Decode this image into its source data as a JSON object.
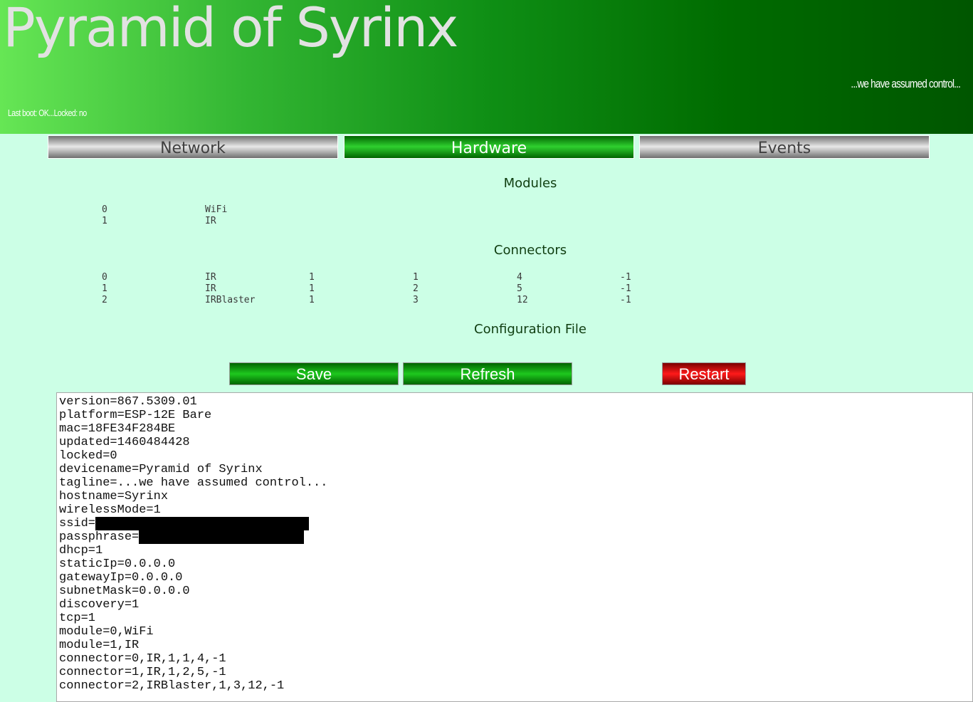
{
  "header": {
    "title": "Pyramid of Syrinx",
    "tagline": "...we have assumed control...",
    "boot_status": "Last boot: OK...Locked: no"
  },
  "tabs": [
    {
      "label": "Network",
      "active": false
    },
    {
      "label": "Hardware",
      "active": true
    },
    {
      "label": "Events",
      "active": false
    }
  ],
  "modules": {
    "heading": "Modules",
    "rows": [
      {
        "id": "0",
        "name": "WiFi"
      },
      {
        "id": "1",
        "name": "IR"
      }
    ]
  },
  "connectors": {
    "heading": "Connectors",
    "rows": [
      {
        "id": "0",
        "type": "IR",
        "a": "1",
        "b": "1",
        "c": "4",
        "d": "-1"
      },
      {
        "id": "1",
        "type": "IR",
        "a": "1",
        "b": "2",
        "c": "5",
        "d": "-1"
      },
      {
        "id": "2",
        "type": "IRBlaster",
        "a": "1",
        "b": "3",
        "c": "12",
        "d": "-1"
      }
    ]
  },
  "config": {
    "heading": "Configuration File",
    "buttons": {
      "save": "Save",
      "refresh": "Refresh",
      "restart": "Restart"
    },
    "lines": [
      "version=867.5309.01",
      "platform=ESP-12E Bare",
      "mac=18FE34F284BE",
      "updated=1460484428",
      "locked=0",
      "devicename=Pyramid of Syrinx",
      "tagline=...we have assumed control...",
      "hostname=Syrinx",
      "wirelessMode=1",
      "ssid=",
      "passphrase=",
      "dhcp=1",
      "staticIp=0.0.0.0",
      "gatewayIp=0.0.0.0",
      "subnetMask=0.0.0.0",
      "discovery=1",
      "tcp=1",
      "module=0,WiFi",
      "module=1,IR",
      "connector=0,IR,1,1,4,-1",
      "connector=1,IR,1,2,5,-1",
      "connector=2,IRBlaster,1,3,12,-1"
    ]
  },
  "colors": {
    "background": "#ccffe6",
    "header_green": "#006400",
    "accent_green": "#1ec81e",
    "restart_red": "#ff1a1a"
  }
}
